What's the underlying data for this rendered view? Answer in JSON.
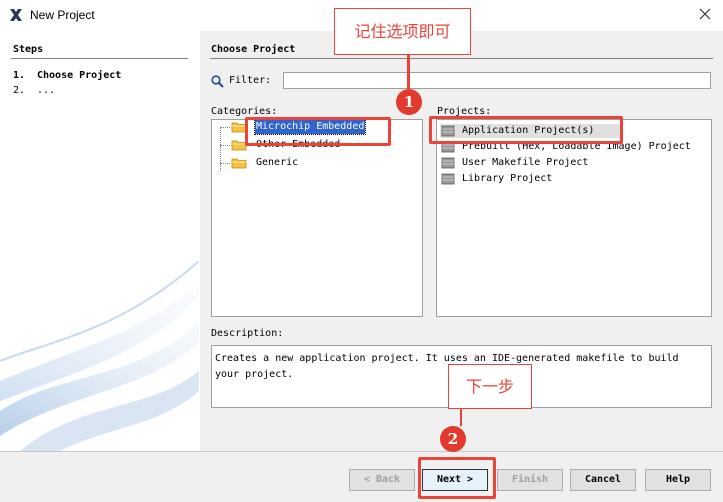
{
  "window": {
    "title": "New Project"
  },
  "steps": {
    "title": "Steps",
    "items": [
      {
        "num": "1.",
        "label": "Choose Project",
        "active": true
      },
      {
        "num": "2.",
        "label": "...",
        "active": false
      }
    ]
  },
  "main": {
    "pane_title": "Choose Project",
    "filter_label": "Filter:",
    "filter_value": "",
    "categories_label": "Categories:",
    "categories": [
      {
        "label": "Microchip Embedded",
        "selected": true
      },
      {
        "label": "Other Embedded",
        "selected": false
      },
      {
        "label": "Generic",
        "selected": false
      }
    ],
    "projects_label": "Projects:",
    "projects": [
      {
        "label": "Application Project(s)",
        "selected": true
      },
      {
        "label": "Prebuilt (Hex, Loadable Image) Project",
        "selected": false
      },
      {
        "label": "User Makefile Project",
        "selected": false
      },
      {
        "label": "Library Project",
        "selected": false
      }
    ],
    "description_label": "Description:",
    "description": "Creates a new application project. It uses an IDE-generated makefile to build your project."
  },
  "buttons": {
    "back": "< Back",
    "next": "Next >",
    "finish": "Finish",
    "cancel": "Cancel",
    "help": "Help"
  },
  "annotations": {
    "callout_top": "记住选项即可",
    "callout_bottom": "下一步",
    "badge_1": "1",
    "badge_2": "2",
    "accent_color": "#e8443a"
  }
}
